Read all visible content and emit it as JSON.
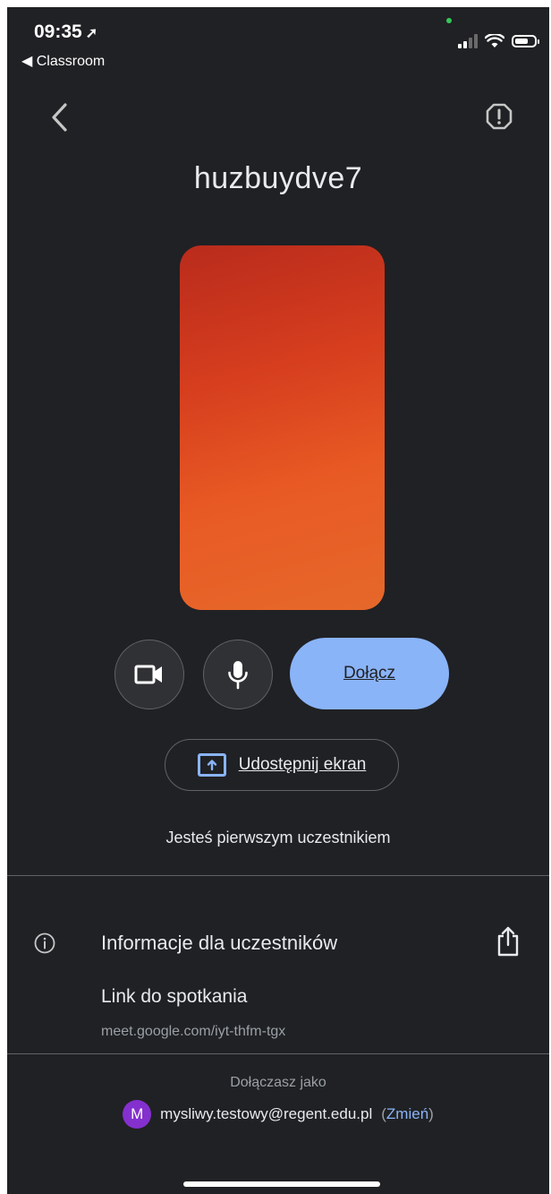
{
  "status_bar": {
    "time": "09:35",
    "back_app": "◀ Classroom"
  },
  "meeting": {
    "code": "huzbuydve7",
    "join_label": "Dołącz",
    "share_screen_label": "Udostępnij ekran",
    "first_participant": "Jesteś pierwszym uczestnikiem"
  },
  "info": {
    "title": "Informacje dla uczestników",
    "link_label": "Link do spotkania",
    "link_url": "meet.google.com/iyt-thfm-tgx"
  },
  "account": {
    "joining_as": "Dołączasz jako",
    "avatar_letter": "M",
    "email": "mysliwy.testowy@regent.edu.pl",
    "change_label": "Zmień"
  },
  "colors": {
    "background": "#202124",
    "accent": "#8ab4f8",
    "avatar": "#8430ce"
  }
}
